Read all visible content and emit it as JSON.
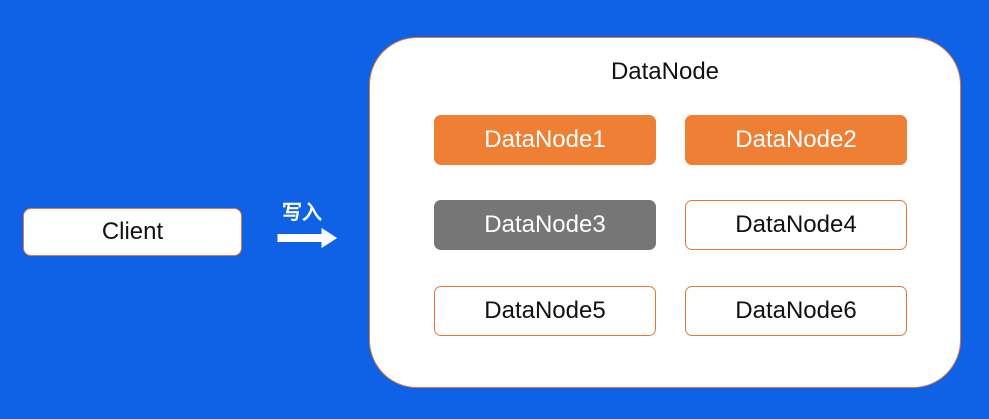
{
  "client": {
    "label": "Client"
  },
  "write": {
    "label": "写入"
  },
  "cluster": {
    "title": "DataNode",
    "nodes": [
      {
        "label": "DataNode1",
        "state": "orange"
      },
      {
        "label": "DataNode2",
        "state": "orange"
      },
      {
        "label": "DataNode3",
        "state": "gray"
      },
      {
        "label": "DataNode4",
        "state": "outline"
      },
      {
        "label": "DataNode5",
        "state": "outline"
      },
      {
        "label": "DataNode6",
        "state": "outline"
      }
    ]
  },
  "colors": {
    "background": "#0f62e6",
    "accent_orange": "#ee7f34",
    "inactive_gray": "#767676",
    "border_orange": "#e07a35"
  },
  "icons": {
    "arrow": "right-arrow-icon"
  }
}
